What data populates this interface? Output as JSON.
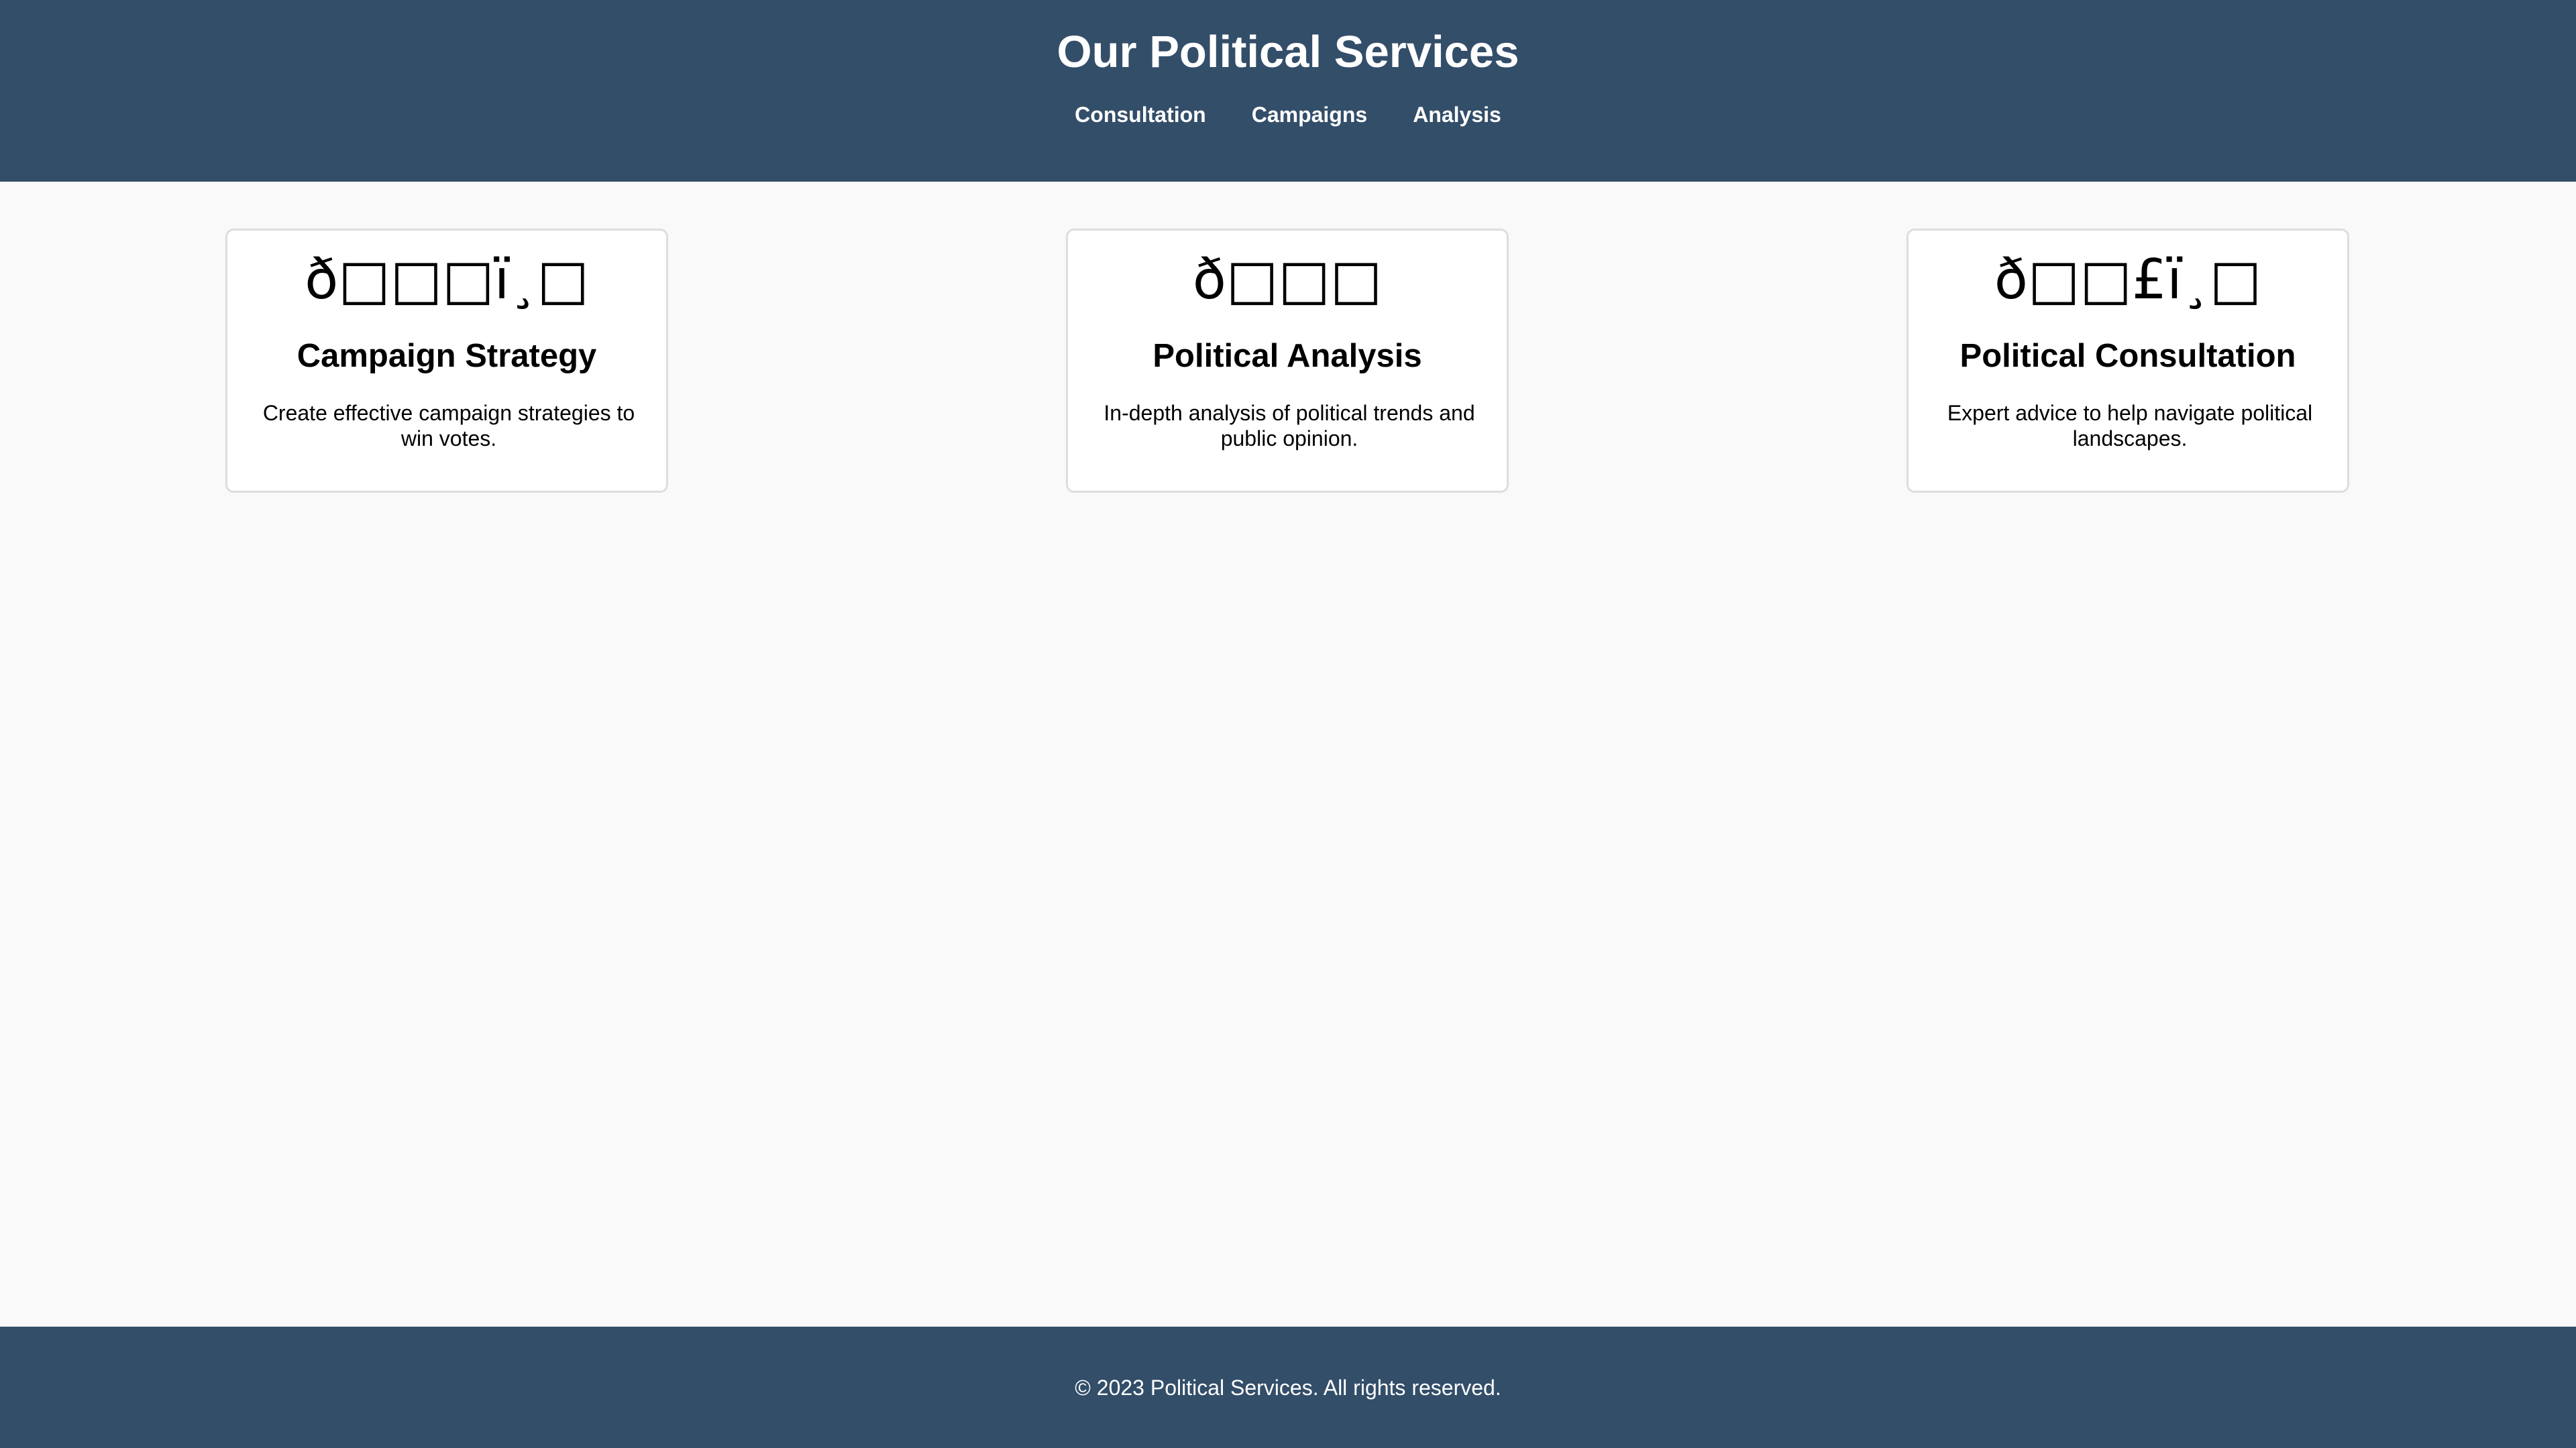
{
  "header": {
    "title": "Our Political Services",
    "nav": [
      {
        "label": "Consultation"
      },
      {
        "label": "Campaigns"
      },
      {
        "label": "Analysis"
      }
    ]
  },
  "services": [
    {
      "icon": "ð□□□ï¸□",
      "title": "Campaign Strategy",
      "description": "Create effective campaign strategies to win votes."
    },
    {
      "icon": "ð□□□",
      "title": "Political Analysis",
      "description": "In-depth analysis of political trends and public opinion."
    },
    {
      "icon": "ð□□£ï¸□",
      "title": "Political Consultation",
      "description": "Expert advice to help navigate political landscapes."
    }
  ],
  "footer": {
    "text": "© 2023 Political Services. All rights reserved."
  },
  "colors": {
    "header_bg": "#334e69",
    "footer_bg": "#334e69",
    "page_bg": "#f9f9f9",
    "card_bg": "#ffffff",
    "card_border": "#dddddd"
  }
}
